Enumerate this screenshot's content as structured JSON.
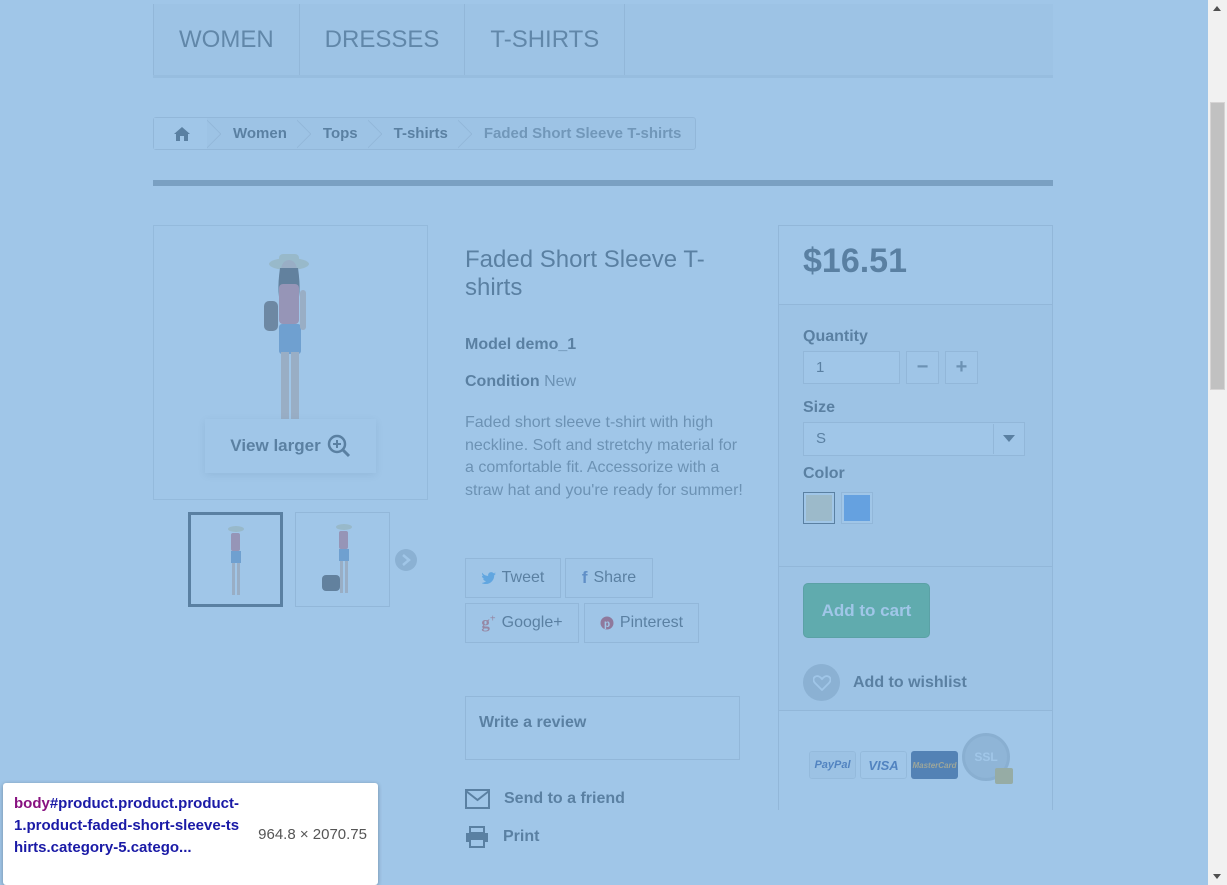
{
  "menu": {
    "items": [
      "WOMEN",
      "DRESSES",
      "T-SHIRTS"
    ]
  },
  "breadcrumb": {
    "items": [
      "Women",
      "Tops",
      "T-shirts"
    ],
    "current": "Faded Short Sleeve T-shirts"
  },
  "product": {
    "title": "Faded Short Sleeve T-shirts",
    "model_label": "Model",
    "model_value": "demo_1",
    "condition_label": "Condition",
    "condition_value": "New",
    "description": "Faded short sleeve t-shirt with high neckline. Soft and stretchy material for a comfortable fit. Accessorize with a straw hat and you're ready for summer!",
    "view_larger": "View larger"
  },
  "social": {
    "tweet": "Tweet",
    "share": "Share",
    "google": "Google+",
    "pinterest": "Pinterest"
  },
  "review": "Write a review",
  "links": {
    "send": "Send to a friend",
    "print": "Print"
  },
  "buy": {
    "price": "$16.51",
    "quantity_label": "Quantity",
    "quantity_value": "1",
    "minus": "−",
    "plus": "+",
    "size_label": "Size",
    "size_value": "S",
    "color_label": "Color",
    "colors": [
      "#f3dba7",
      "#5494e8"
    ],
    "add_to_cart": "Add to cart",
    "wishlist": "Add to wishlist"
  },
  "payment": {
    "paypal": "PayPal",
    "visa": "VISA",
    "mastercard": "MasterCard",
    "ssl": "SSL"
  },
  "devtools": {
    "tag": "body",
    "selector": "#product.product.product-1.product-faded-short-sleeve-tshirts.category-5.catego...",
    "dimensions": "964.8 × 2070.75"
  }
}
